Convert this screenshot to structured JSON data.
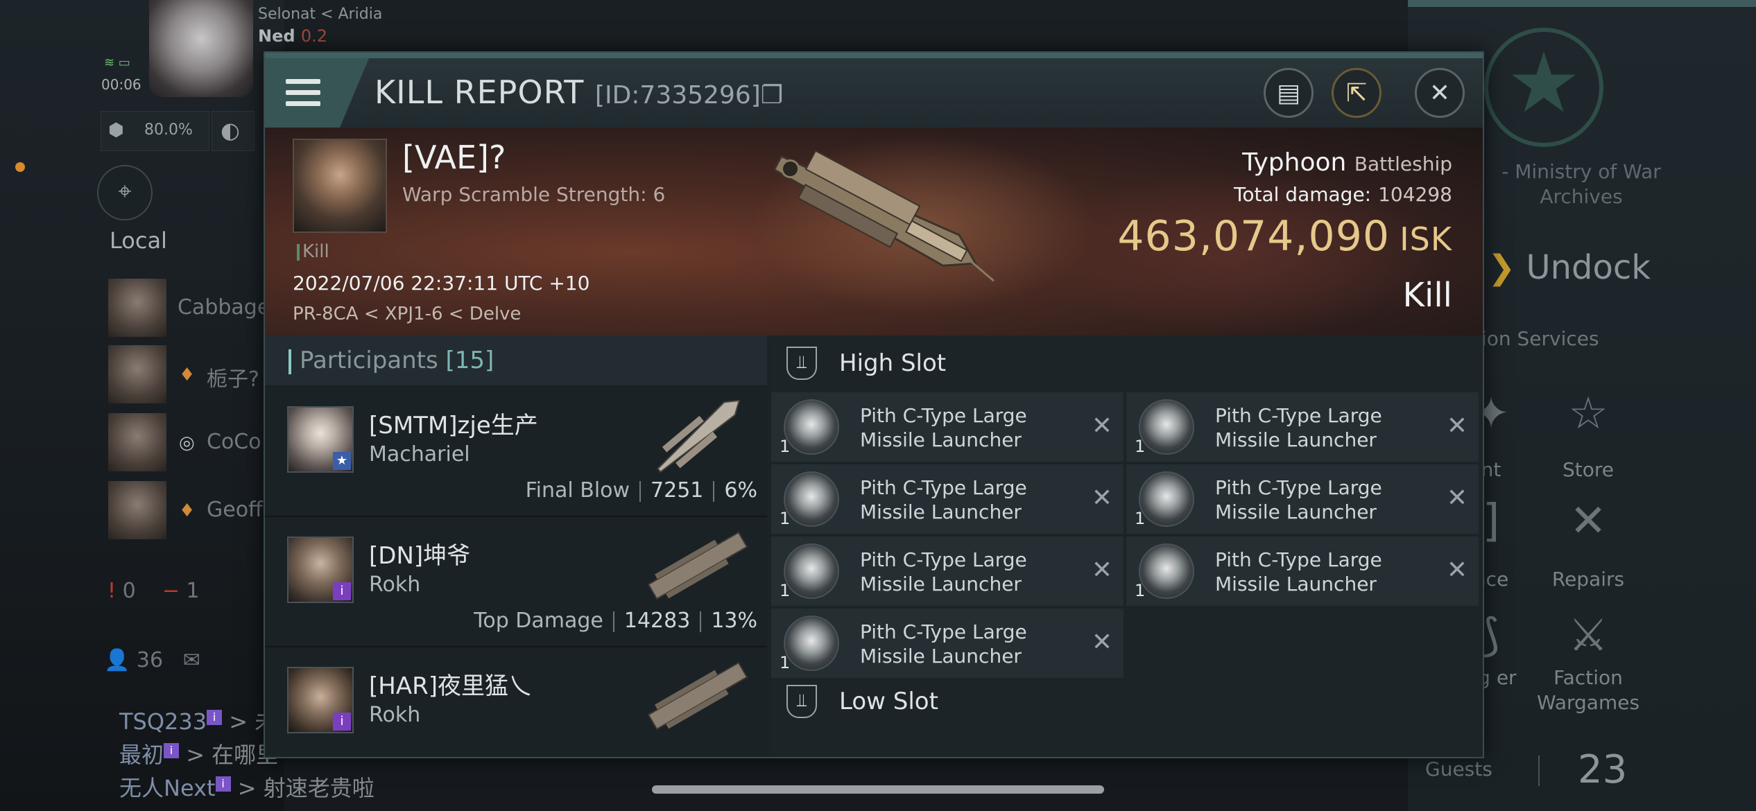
{
  "background": {
    "system": "Selonat < Aridia",
    "pilot_name": "Ned",
    "pilot_sec": "0.2",
    "clock": "00:06",
    "cargo_percent": "80.0%",
    "local_title": "Local",
    "local_members": [
      {
        "name": "Cabbage"
      },
      {
        "name": "栀子?"
      },
      {
        "name": "CoCo"
      },
      {
        "name": "Geoff"
      }
    ],
    "count_red": "0",
    "count_minus": "1",
    "people_count": "36",
    "chat": [
      {
        "user": "TSQ233",
        "msg": "> 未"
      },
      {
        "user": "最初",
        "msg": "> 在哪里"
      },
      {
        "user": "无人Next",
        "msg": "> 射速老贵啦"
      }
    ],
    "ministry": "- Ministry of War Archives",
    "undock": "Undock",
    "station_services": "tion Services",
    "services": [
      {
        "label": "nt",
        "icon": "star-icon"
      },
      {
        "label": "Store",
        "icon": "store-icon"
      },
      {
        "label": "nce",
        "icon": "insurance-icon"
      },
      {
        "label": "Repairs",
        "icon": "wrench-icon"
      },
      {
        "label": "ng er",
        "icon": "cloning-icon"
      },
      {
        "label": "Faction Wargames",
        "icon": "wargames-icon"
      }
    ],
    "guests_label": "Guests",
    "guests_count": "23"
  },
  "report": {
    "title": "KILL REPORT",
    "id": "[ID:7335296]",
    "victim": {
      "name": "[VAE]?",
      "subtitle": "Warp Scramble Strength: 6",
      "tag": "Kill",
      "datetime": "2022/07/06 22:37:11 UTC +10",
      "location": "PR-8CA < XPJ1-6 < Delve"
    },
    "ship": {
      "name": "Typhoon",
      "class": "Battleship",
      "total_damage_label": "Total damage:",
      "total_damage": "104298",
      "isk_value": "463,074,090",
      "isk_unit": "ISK",
      "result": "Kill"
    },
    "participants": {
      "label": "Participants",
      "count": "[15]",
      "rows": [
        {
          "name": "[SMTM]zje生产",
          "ship": "Machariel",
          "role": "Final Blow",
          "damage": "7251",
          "pct": "6%",
          "corp_color": "#3b5ea8",
          "corp_glyph": "★"
        },
        {
          "name": "[DN]坤爷",
          "ship": "Rokh",
          "role": "Top Damage",
          "damage": "14283",
          "pct": "13%",
          "corp_color": "#7a3fc0",
          "corp_glyph": "i"
        },
        {
          "name": "[HAR]夜里猛乀",
          "ship": "Rokh",
          "role": "",
          "damage": "",
          "pct": "",
          "corp_color": "#7a3fc0",
          "corp_glyph": "i"
        }
      ]
    },
    "high_slot": {
      "label": "High Slot",
      "modules": [
        {
          "name": "Pith C-Type Large Missile Launcher",
          "qty": "1"
        },
        {
          "name": "Pith C-Type Large Missile Launcher",
          "qty": "1"
        },
        {
          "name": "Pith C-Type Large Missile Launcher",
          "qty": "1"
        },
        {
          "name": "Pith C-Type Large Missile Launcher",
          "qty": "1"
        },
        {
          "name": "Pith C-Type Large Missile Launcher",
          "qty": "1"
        },
        {
          "name": "Pith C-Type Large Missile Launcher",
          "qty": "1"
        },
        {
          "name": "Pith C-Type Large Missile Launcher",
          "qty": "1"
        }
      ]
    },
    "low_slot": {
      "label": "Low Slot"
    }
  }
}
